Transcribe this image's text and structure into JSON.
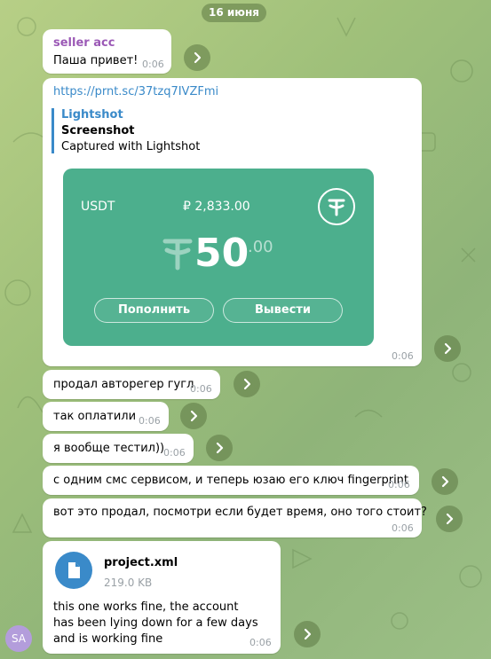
{
  "date_label": "16 июня",
  "avatar_initials": "SA",
  "messages": [
    {
      "sender": "seller acc",
      "text": "Паша привет!",
      "time": "0:06"
    },
    {
      "link": "https://prnt.sc/37tzq7IVZFmi",
      "preview": {
        "site": "Lightshot",
        "title": "Screenshot",
        "description": "Captured with Lightshot",
        "card": {
          "currency": "USDT",
          "balance": "₽ 2,833.00",
          "amount_int": "50",
          "amount_dec": ".00",
          "deposit_label": "Пополнить",
          "withdraw_label": "Вывести"
        }
      },
      "time": "0:06"
    },
    {
      "text": "продал авторегер гугл",
      "time": "0:06"
    },
    {
      "text": "так оплатили",
      "time": "0:06"
    },
    {
      "text": "я вообще тестил))",
      "time": "0:06"
    },
    {
      "text": "с одним смс сервисом, и теперь юзаю его ключ fingerprint",
      "time": "0:06"
    },
    {
      "text": "вот это продал, посмотри если будет время, оно того стоит?",
      "time": "0:06"
    },
    {
      "file": {
        "name": "project.xml",
        "size": "219.0 KB"
      },
      "text": "this one works fine, the account has been lying down for a few days and is working fine",
      "time": "0:06"
    }
  ],
  "colors": {
    "accent": "#3a8ac9",
    "sender": "#9b59b6",
    "card": "#4caf8d"
  },
  "icons": {
    "forward": "forward-arrow-icon",
    "file": "document-icon",
    "tether": "tether-logo-icon"
  }
}
